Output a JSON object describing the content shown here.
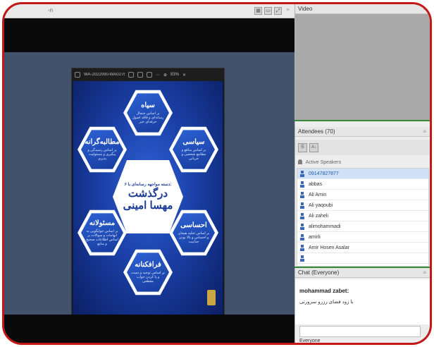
{
  "share_pod": {
    "title": "-n",
    "header_icons": [
      "grid-icon",
      "monitor-icon",
      "fullscreen-icon",
      "menu-icon"
    ],
    "document": {
      "filename": "WA-2022090-WA0276.jpg",
      "zoom": "83%"
    },
    "poster": {
      "center_subtitle": "۶ دسته مواجهه رسانه‌ای با:",
      "center_title_line1": "درگذشت",
      "center_title_line2": "مهسا امینی",
      "hexes": [
        {
          "title": "سیاه",
          "desc": "بر اساس جنجال رسانه‌ای و فاقد اصول حرفه‌ای خبر"
        },
        {
          "title": "سیاسی",
          "desc": "بر اساس منافع و مطامع شخصی و جریانی"
        },
        {
          "title": "احساسی",
          "desc": "بر اساس تخلیه هیجان و احساس و بالا بودن جذابیت"
        },
        {
          "title": "فرافکنانه",
          "desc": "بر اساس توجیه و دست و پا کردن جواب مقطعی"
        },
        {
          "title": "مسئولانه",
          "desc": "بر اساس جوابگویی به ابهامات و سوالات بر اساس اطلاعات صحیح و منابع"
        },
        {
          "title": "مطالبه‌گرانه",
          "desc": "بر اساس رسیدگی و پیگیری و مسئولیت پذیری"
        }
      ]
    }
  },
  "video_pod": {
    "title": "Video"
  },
  "attendees_pod": {
    "title": "Attendees",
    "count": "(70)",
    "group_label": "Active Speakers",
    "attendees": [
      {
        "name": "09147827877",
        "selected": true
      },
      {
        "name": "abbas",
        "selected": false
      },
      {
        "name": "Ali Amin",
        "selected": false
      },
      {
        "name": "Ali yaqoubi",
        "selected": false
      },
      {
        "name": "Ali zaheli",
        "selected": false
      },
      {
        "name": "alimohammadi",
        "selected": false
      },
      {
        "name": "amirli",
        "selected": false
      },
      {
        "name": "Amir Hosen Asalar",
        "selected": false
      },
      {
        "name": "",
        "selected": false
      }
    ]
  },
  "chat_pod": {
    "title": "Chat",
    "scope": "(Everyone)",
    "messages": [
      {
        "user": "mohammad zabet:",
        "text": "با زود فضای رزرو سرورتی"
      }
    ],
    "recipient": "Everyone"
  }
}
